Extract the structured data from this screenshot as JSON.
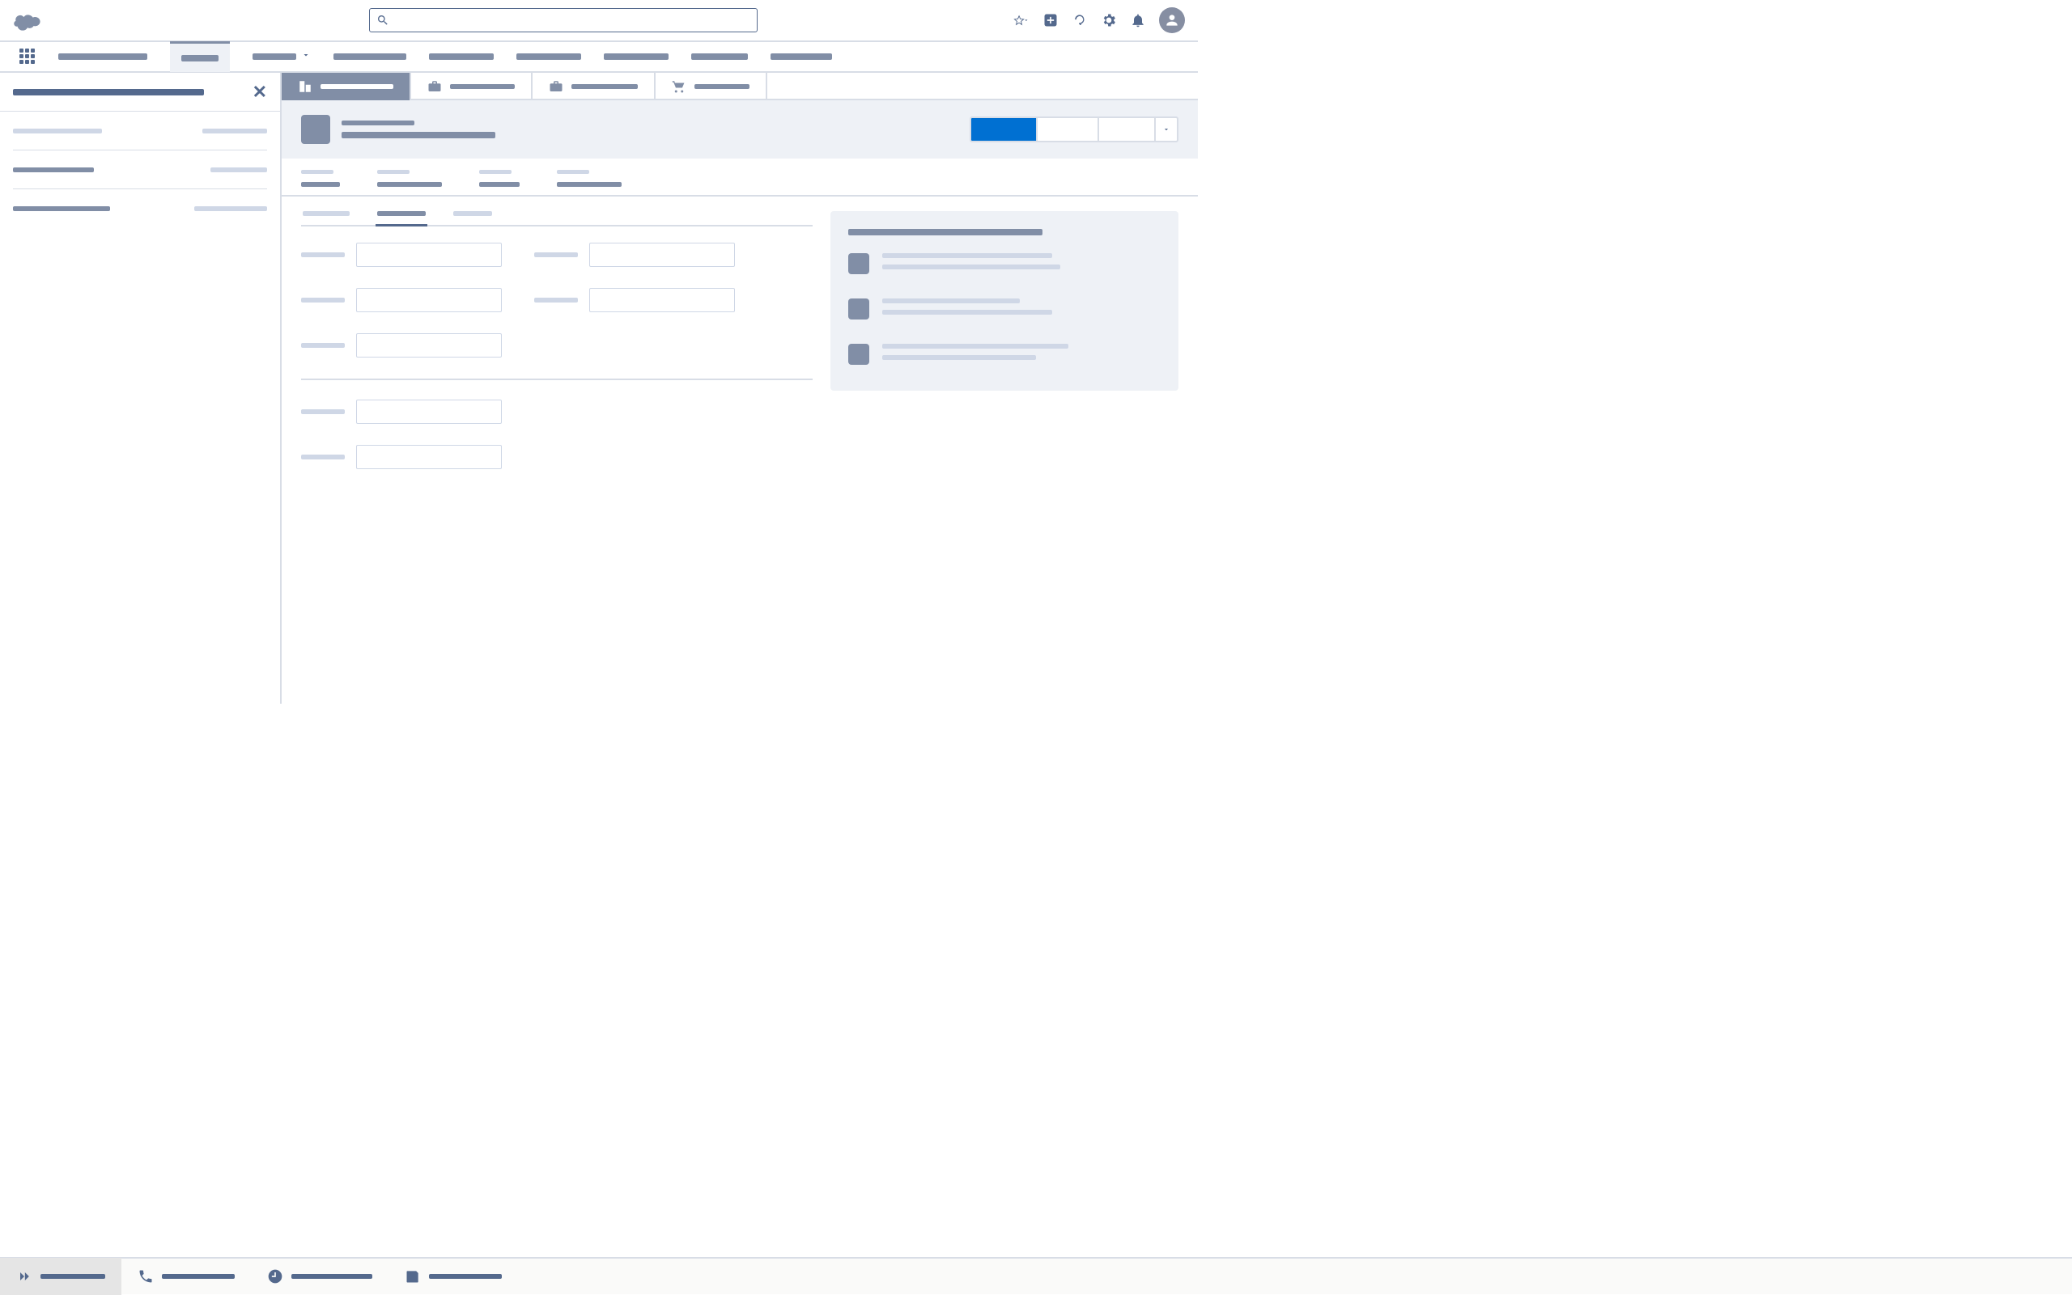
{
  "global": {
    "search_placeholder": ""
  },
  "topnav": {
    "items": [
      "",
      "",
      "",
      "",
      "",
      "",
      "",
      "",
      ""
    ]
  },
  "split": {
    "title": "",
    "rows": [
      {
        "a": "",
        "b": ""
      },
      {
        "a": "",
        "b": ""
      },
      {
        "a": "",
        "b": ""
      }
    ]
  },
  "workspace_tabs": [
    {
      "label": "",
      "icon": "accounts",
      "active": true
    },
    {
      "label": "",
      "icon": "briefcase"
    },
    {
      "label": "",
      "icon": "briefcase"
    },
    {
      "label": "",
      "icon": "cart"
    }
  ],
  "record": {
    "type": "",
    "name": ""
  },
  "actions": {
    "primary": "",
    "secondary1": "",
    "secondary2": ""
  },
  "highlights": [
    {
      "label": "",
      "value": ""
    },
    {
      "label": "",
      "value": ""
    },
    {
      "label": "",
      "value": ""
    },
    {
      "label": "",
      "value": ""
    }
  ],
  "subtabs": [
    "",
    "",
    ""
  ],
  "form": {
    "group1": [
      [
        {
          "label": "",
          "value": ""
        },
        {
          "label": "",
          "value": ""
        }
      ],
      [
        {
          "label": "",
          "value": ""
        },
        {
          "label": "",
          "value": ""
        }
      ],
      [
        {
          "label": "",
          "value": ""
        }
      ]
    ],
    "group2": [
      [
        {
          "label": "",
          "value": ""
        }
      ],
      [
        {
          "label": "",
          "value": ""
        }
      ]
    ]
  },
  "side": {
    "title": "",
    "items": [
      {
        "line1": "",
        "line2": ""
      },
      {
        "line1": "",
        "line2": ""
      },
      {
        "line1": "",
        "line2": ""
      }
    ]
  },
  "utility": [
    "",
    "",
    "",
    ""
  ]
}
